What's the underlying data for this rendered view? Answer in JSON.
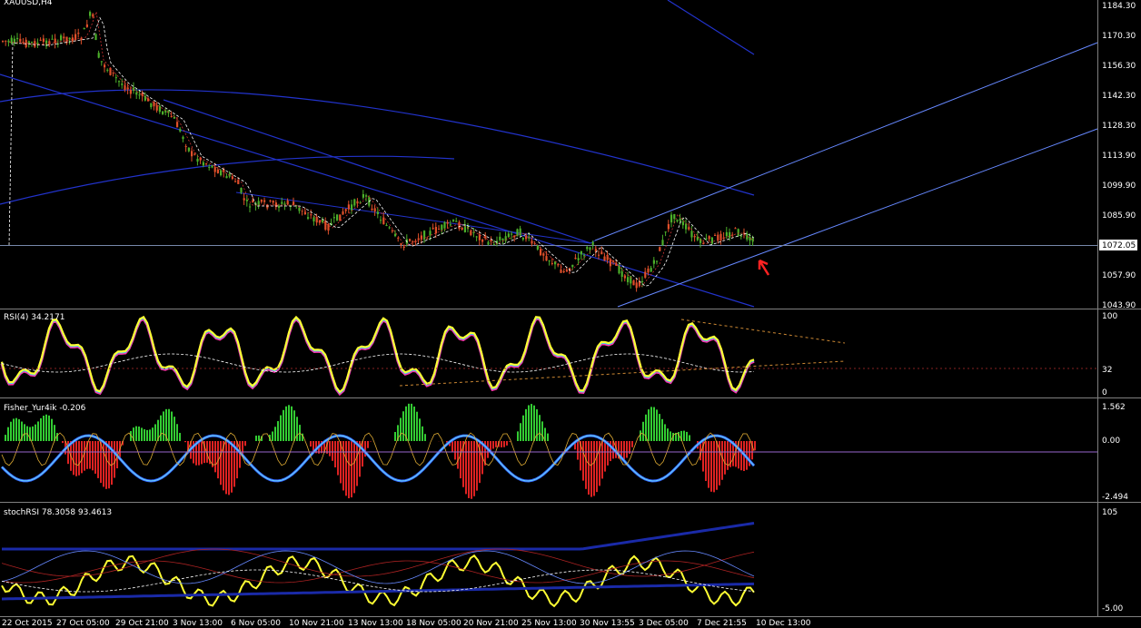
{
  "symbol_label": "XAUUSD,H4",
  "current_price": "1072.05",
  "price_axis": [
    "1184.30",
    "1170.30",
    "1156.30",
    "1142.30",
    "1128.30",
    "1113.90",
    "1099.90",
    "1085.90",
    "1072.05",
    "1057.90",
    "1043.90"
  ],
  "rsi": {
    "label": "RSI(4) 34.2171",
    "axis": [
      "100",
      "32",
      "0"
    ]
  },
  "fisher": {
    "label": "Fisher_Yur4ik -0.206",
    "axis": [
      "1.562",
      "0.00",
      "-2.494"
    ]
  },
  "stoch": {
    "label": "stochRSI 78.3058 93.4613",
    "axis": [
      "105",
      "-5.00"
    ]
  },
  "time_axis": [
    "22 Oct 2015",
    "27 Oct 05:00",
    "29 Oct 21:00",
    "3 Nov 13:00",
    "6 Nov 05:00",
    "10 Nov 21:00",
    "13 Nov 13:00",
    "18 Nov 05:00",
    "20 Nov 21:00",
    "25 Nov 13:00",
    "30 Nov 13:55",
    "3 Dec 05:00",
    "7 Dec 21:55",
    "10 Dec 13:00"
  ],
  "colors": {
    "background": "#000000",
    "bull": "#4caf2a",
    "bear": "#e0502a",
    "channel": "#2233cc",
    "trend": "#6688ff",
    "rsi_main": "#ffff33",
    "hist_pos": "#33cc33",
    "hist_neg": "#dd2222",
    "arrow": "#ff2222"
  }
}
